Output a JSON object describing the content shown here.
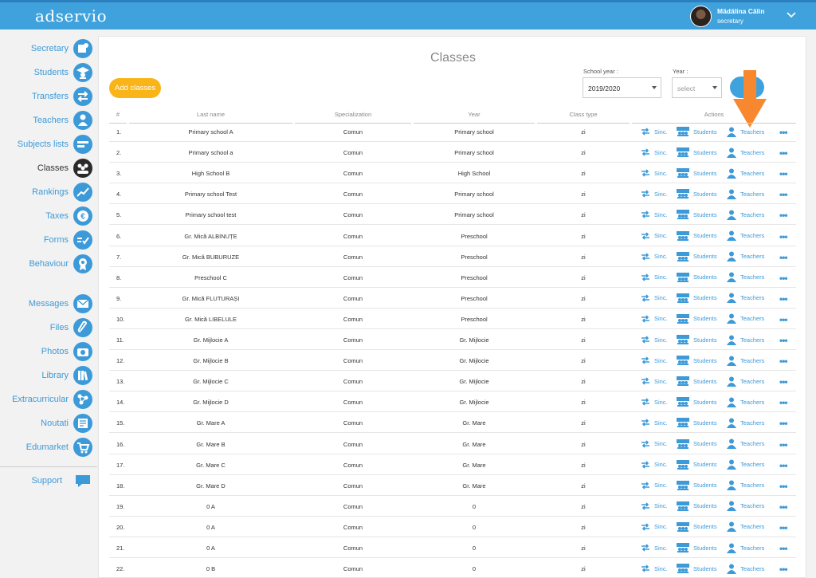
{
  "app": {
    "logo": "adservio"
  },
  "user": {
    "name": "Mădălina Călin",
    "role": "secretary"
  },
  "sidebar": {
    "items": [
      {
        "label": "Secretary",
        "icon": "certificate-icon"
      },
      {
        "label": "Students",
        "icon": "graduate-icon"
      },
      {
        "label": "Transfers",
        "icon": "transfer-arrows-icon"
      },
      {
        "label": "Teachers",
        "icon": "person-icon"
      },
      {
        "label": "Subjects lists",
        "icon": "list-icon"
      },
      {
        "label": "Classes",
        "icon": "group-icon"
      },
      {
        "label": "Rankings",
        "icon": "chart-line-icon"
      },
      {
        "label": "Taxes",
        "icon": "euro-icon"
      },
      {
        "label": "Forms",
        "icon": "form-check-icon"
      },
      {
        "label": "Behaviour",
        "icon": "badge-icon"
      },
      {
        "label": "Messages",
        "icon": "envelope-icon"
      },
      {
        "label": "Files",
        "icon": "paperclip-icon"
      },
      {
        "label": "Photos",
        "icon": "camera-icon"
      },
      {
        "label": "Library",
        "icon": "books-icon"
      },
      {
        "label": "Extracurricular",
        "icon": "network-icon"
      },
      {
        "label": "Noutati",
        "icon": "news-icon"
      },
      {
        "label": "Edumarket",
        "icon": "cart-icon"
      }
    ],
    "support": "Support",
    "active": "Classes"
  },
  "main": {
    "title": "Classes",
    "add_button": "Add classes",
    "filters": {
      "school_year_label": "School year :",
      "school_year_value": "2019/2020",
      "year_label": "Year :",
      "year_placeholder": "select"
    },
    "table": {
      "headers": [
        "#",
        "Last name",
        "Specialization",
        "Year",
        "Class type",
        "Actions"
      ],
      "actions": {
        "sync": "Sinc.",
        "students": "Students",
        "teachers": "Teachers",
        "more": "•••"
      },
      "rows": [
        [
          "1.",
          "Primary school A",
          "Comun",
          "Primary school",
          "zi"
        ],
        [
          "2.",
          "Primary school a",
          "Comun",
          "Primary school",
          "zi"
        ],
        [
          "3.",
          "High School B",
          "Comun",
          "High School",
          "zi"
        ],
        [
          "4.",
          "Primary school Test",
          "Comun",
          "Primary school",
          "zi"
        ],
        [
          "5.",
          "Primary school test",
          "Comun",
          "Primary school",
          "zi"
        ],
        [
          "6.",
          "Gr. Mică ALBINUȚE",
          "Comun",
          "Preschool",
          "zi"
        ],
        [
          "7.",
          "Gr. Mică BUBURUZE",
          "Comun",
          "Preschool",
          "zi"
        ],
        [
          "8.",
          "Preschool C",
          "Comun",
          "Preschool",
          "zi"
        ],
        [
          "9.",
          "Gr. Mică FLUTURAȘI",
          "Comun",
          "Preschool",
          "zi"
        ],
        [
          "10.",
          "Gr. Mică LIBELULE",
          "Comun",
          "Preschool",
          "zi"
        ],
        [
          "11.",
          "Gr. Mijlocie A",
          "Comun",
          "Gr. Mijlocie",
          "zi"
        ],
        [
          "12.",
          "Gr. Mijlocie B",
          "Comun",
          "Gr. Mijlocie",
          "zi"
        ],
        [
          "13.",
          "Gr. Mijlocie C",
          "Comun",
          "Gr. Mijlocie",
          "zi"
        ],
        [
          "14.",
          "Gr. Mijlocie D",
          "Comun",
          "Gr. Mijlocie",
          "zi"
        ],
        [
          "15.",
          "Gr. Mare A",
          "Comun",
          "Gr. Mare",
          "zi"
        ],
        [
          "16.",
          "Gr. Mare B",
          "Comun",
          "Gr. Mare",
          "zi"
        ],
        [
          "17.",
          "Gr. Mare C",
          "Comun",
          "Gr. Mare",
          "zi"
        ],
        [
          "18.",
          "Gr. Mare D",
          "Comun",
          "Gr. Mare",
          "zi"
        ],
        [
          "19.",
          "0 A",
          "Comun",
          "0",
          "zi"
        ],
        [
          "20.",
          "0 A",
          "Comun",
          "0",
          "zi"
        ],
        [
          "21.",
          "0 A",
          "Comun",
          "0",
          "zi"
        ],
        [
          "22.",
          "0 B",
          "Comun",
          "0",
          "zi"
        ]
      ]
    }
  },
  "colors": {
    "brand": "#3fa2dd",
    "add_button": "#f9b418",
    "annotation_arrow": "#f7882f"
  }
}
